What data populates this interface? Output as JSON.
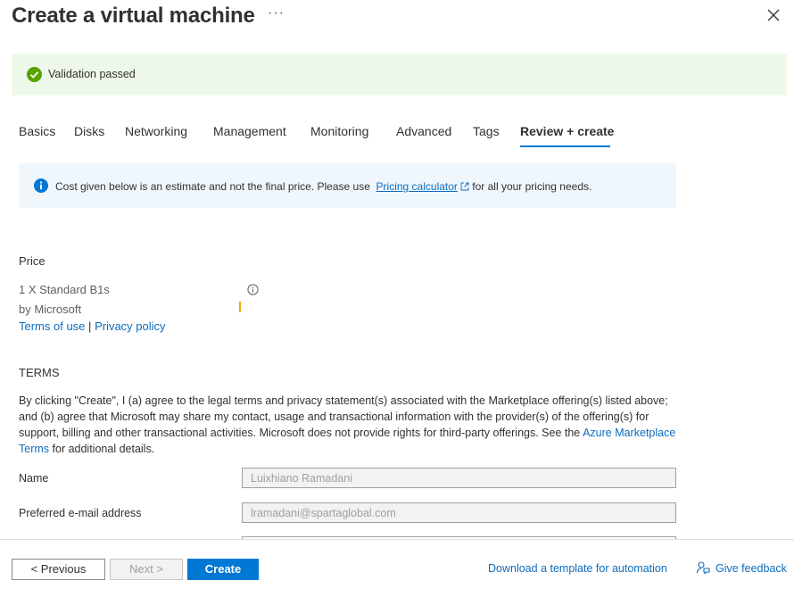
{
  "header": {
    "title": "Create a virtual machine",
    "more_label": "···"
  },
  "validation": {
    "text": "Validation passed",
    "color": "#57a300"
  },
  "tabs": [
    {
      "label": "Basics"
    },
    {
      "label": "Disks"
    },
    {
      "label": "Networking"
    },
    {
      "label": "Management"
    },
    {
      "label": "Monitoring"
    },
    {
      "label": "Advanced"
    },
    {
      "label": "Tags"
    },
    {
      "label": "Review + create",
      "active": true
    }
  ],
  "info": {
    "text_before": "Cost given below is an estimate and not the final price. Please use",
    "link": "Pricing calculator",
    "text_after": "for all your pricing needs."
  },
  "price": {
    "title": "Price",
    "product": "1 X Standard B1s",
    "vendor": "by Microsoft",
    "terms_link": "Terms of use",
    "separator": "|",
    "privacy_link": "Privacy policy"
  },
  "terms": {
    "title": "TERMS",
    "text": "By clicking \"Create\", I (a) agree to the legal terms and privacy statement(s) associated with the Marketplace offering(s) listed above; and (b) agree that Microsoft may share my contact, usage and transactional information with the provider(s) of the offering(s) for support, billing and other transactional activities. Microsoft does not provide rights for third-party offerings. See the",
    "link": "Azure Marketplace Terms",
    "text_after": "for additional details."
  },
  "form": {
    "name_label": "Name",
    "name_value": "Luixhiano Ramadani",
    "email_label": "Preferred e-mail address",
    "email_value": "lramadani@spartaglobal.com"
  },
  "footer": {
    "previous": "< Previous",
    "next": "Next >",
    "create": "Create",
    "download": "Download a template for automation",
    "feedback": "Give feedback"
  },
  "colors": {
    "accent": "#0078d4",
    "link": "#0f6cbd",
    "success": "#57a300",
    "loading": "#f2a900"
  }
}
